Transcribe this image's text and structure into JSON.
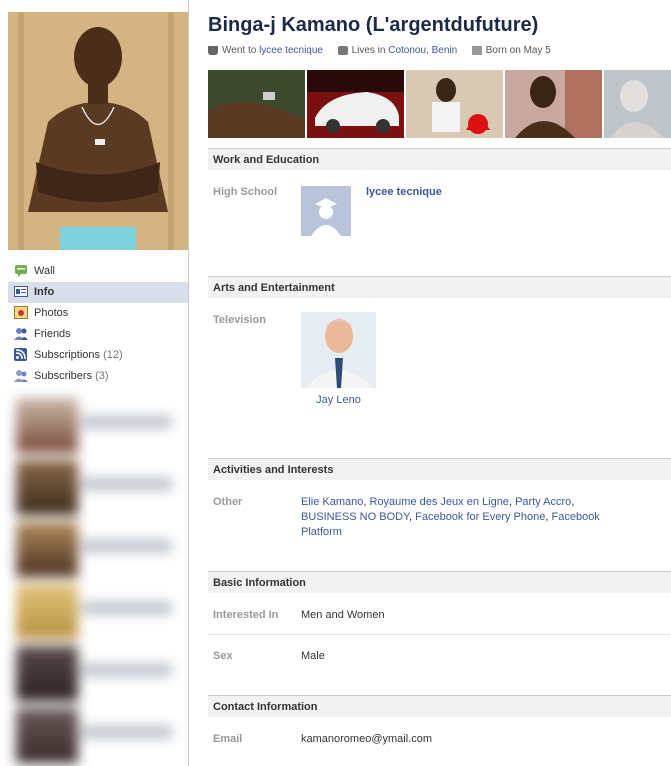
{
  "profile": {
    "name": "Binga-j Kamano (L'argentdufuture)",
    "went_to_prefix": "Went to",
    "school": "lycee tecnique",
    "lives_prefix": "Lives in",
    "city": "Cotonou",
    "country": "Benin",
    "born": "Born on May 5"
  },
  "nav": {
    "items": [
      {
        "label": "Wall",
        "icon": "wall-icon",
        "count": ""
      },
      {
        "label": "Info",
        "icon": "info-icon",
        "count": "",
        "active": true
      },
      {
        "label": "Photos",
        "icon": "photos-icon",
        "count": ""
      },
      {
        "label": "Friends",
        "icon": "friends-icon",
        "count": ""
      },
      {
        "label": "Subscriptions",
        "icon": "subscriptions-icon",
        "count": "(12)"
      },
      {
        "label": "Subscribers",
        "icon": "subscribers-icon",
        "count": "(3)"
      }
    ]
  },
  "sections": {
    "work": {
      "title": "Work and Education",
      "label": "High School",
      "school": "lycee tecnique"
    },
    "arts": {
      "title": "Arts and Entertainment",
      "label": "Television",
      "item": "Jay Leno"
    },
    "activities": {
      "title": "Activities and Interests",
      "label": "Other",
      "items": [
        "Elie Kamano",
        "Royaume des Jeux en Ligne",
        "Party Accro",
        "BUSINESS NO BODY",
        "Facebook for Every Phone",
        "Facebook Platform"
      ],
      "separator": ","
    },
    "basic": {
      "title": "Basic Information",
      "interested_label": "Interested In",
      "interested_value": "Men and Women",
      "sex_label": "Sex",
      "sex_value": "Male"
    },
    "contact": {
      "title": "Contact Information",
      "email_label": "Email",
      "email_value": "kamanoromeo@ymail.com"
    }
  },
  "colors": {
    "link": "#3b5998",
    "header_bg": "#f2f2f2",
    "nav_active": "#d8dfea"
  }
}
